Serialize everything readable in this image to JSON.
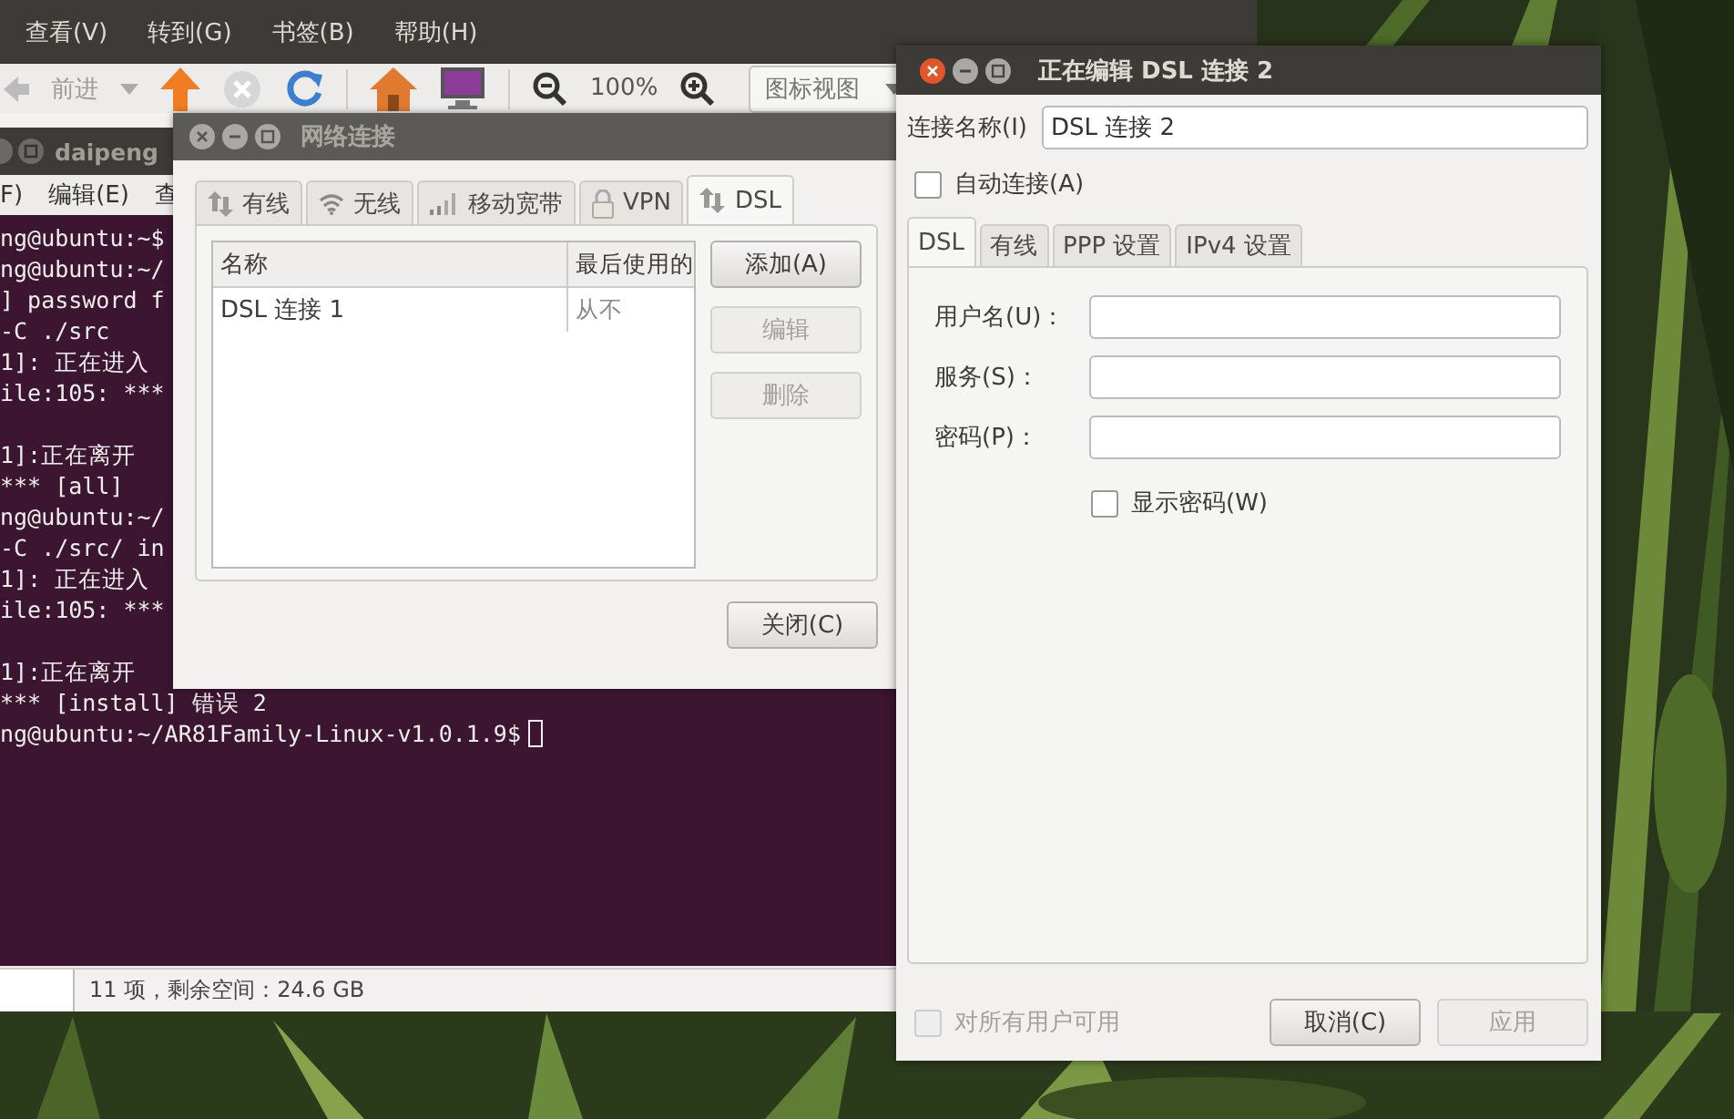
{
  "file_manager": {
    "menu": [
      "查看(V)",
      "转到(G)",
      "书签(B)",
      "帮助(H)"
    ],
    "toolbar": {
      "forward": "前进",
      "zoom": "100%",
      "view": "图标视图"
    },
    "status_bar": "11 项，剩余空间：24.6 GB"
  },
  "terminal": {
    "title": "daipeng",
    "menu": [
      "F)",
      "编辑(E)",
      "查"
    ],
    "blocks": [
      [
        "ng@ubuntu:~$",
        "ng@ubuntu:~/",
        "] password f",
        "-C ./src",
        "1]: 正在进入",
        "ile:105: ***"
      ],
      [
        "1]:正在离开",
        "*** [all]",
        "ng@ubuntu:~/",
        "-C ./src/ in",
        "1]: 正在进入",
        "ile:105: ***"
      ],
      [
        "1]:正在离开",
        "*** [install] 错误 2",
        "ng@ubuntu:~/AR81Family-Linux-v1.0.1.9$"
      ]
    ]
  },
  "network_dialog": {
    "title": "网络连接",
    "tabs": [
      {
        "label": "有线",
        "kind": "wired",
        "selected": false
      },
      {
        "label": "无线",
        "kind": "wireless",
        "selected": false
      },
      {
        "label": "移动宽带",
        "kind": "mobile",
        "selected": false
      },
      {
        "label": "VPN",
        "kind": "vpn",
        "selected": false
      },
      {
        "label": "DSL",
        "kind": "dsl",
        "selected": true
      }
    ],
    "columns": [
      "名称",
      "最后使用的"
    ],
    "rows": [
      {
        "name": "DSL 连接 1",
        "last_used": "从不"
      }
    ],
    "buttons": [
      {
        "label": "添加(A)",
        "disabled": false
      },
      {
        "label": "编辑",
        "disabled": true
      },
      {
        "label": "删除",
        "disabled": true
      }
    ],
    "close": "关闭(C)"
  },
  "edit_dialog": {
    "title": "正在编辑 DSL 连接 2",
    "name_label": "连接名称(I)",
    "name_value": "DSL 连接 2",
    "auto_connect": {
      "label": "自动连接(A)",
      "checked": false
    },
    "tabs": [
      {
        "label": "DSL",
        "selected": true
      },
      {
        "label": "有线",
        "selected": false
      },
      {
        "label": "PPP 设置",
        "selected": false
      },
      {
        "label": "IPv4 设置",
        "selected": false
      }
    ],
    "fields": [
      {
        "label": "用户名(U)："
      },
      {
        "label": "服务(S)："
      },
      {
        "label": "密码(P)："
      }
    ],
    "show_password": {
      "label": "显示密码(W)",
      "checked": false
    },
    "all_users": {
      "label": "对所有用户可用",
      "checked": false,
      "disabled": true
    },
    "cancel": "取消(C)",
    "apply": {
      "label": "应用",
      "disabled": true
    }
  }
}
